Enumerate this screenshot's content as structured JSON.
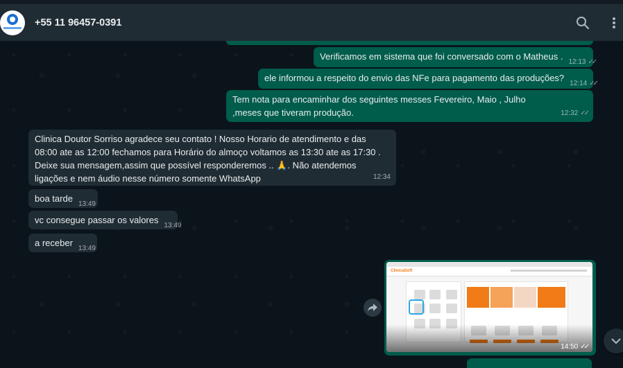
{
  "header": {
    "contact_name": "+55 11 96457-0391",
    "avatar_icon": "clinic-logo-avatar",
    "search_icon": "search-icon",
    "menu_icon": "kebab-menu-icon"
  },
  "messages": [
    {
      "direction": "outgoing",
      "text": "Verificamos em sistema que foi conversado com o Matheus .",
      "time": "12:13",
      "status": "read"
    },
    {
      "direction": "outgoing",
      "text": "ele informou a respeito do envio das NFe para pagamento das produções?",
      "time": "12:14",
      "status": "read"
    },
    {
      "direction": "outgoing",
      "text": "Tem nota para encaminhar dos seguintes messes Fevereiro, Maio , Julho ,meses que tiveram produção.",
      "time": "12:32",
      "status": "read"
    },
    {
      "direction": "incoming",
      "text": "Clinica Doutor Sorriso agradece seu contato !  Nosso Horario de atendimento e das 08:00 ate as 12:00  fechamos para Horário do almoço voltamos as 13:30 ate as 17:30  . Deixe sua mensagem,assim que possível responderemos .. 🙏. Não atendemos ligações  e nem áudio nesse número somente WhatsApp",
      "time": "12:34"
    },
    {
      "direction": "incoming",
      "text": "boa tarde",
      "time": "13:49"
    },
    {
      "direction": "incoming",
      "text": "vc consegue passar os valores",
      "time": "13:49"
    },
    {
      "direction": "incoming",
      "text": "a receber",
      "time": "13:49"
    },
    {
      "direction": "outgoing",
      "type": "image",
      "time": "14:50",
      "status": "read",
      "brand_text": "ClinicaSoft"
    }
  ],
  "colors": {
    "chat_bg": "#0b141a",
    "header_bg": "#202c33",
    "outgoing_bubble": "#005c4b",
    "incoming_bubble": "#202c33",
    "text": "#e9edef"
  }
}
